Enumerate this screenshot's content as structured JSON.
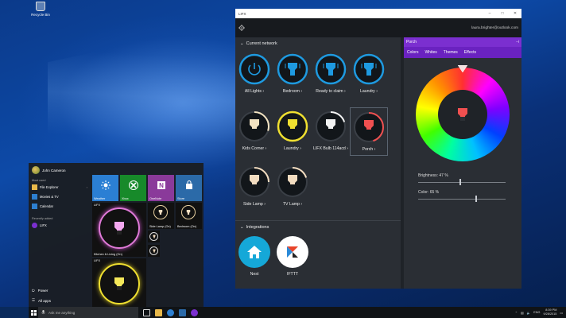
{
  "desktop": {
    "recycle_bin_label": "Recycle Bin"
  },
  "start_menu": {
    "user_name": "John Cameron",
    "most_used_label": "Most used",
    "most_used": [
      {
        "label": "File Explorer",
        "icon": "folder-icon",
        "color": "#e8b84a"
      },
      {
        "label": "Movies & TV",
        "icon": "film-icon",
        "color": "#2d7fd0"
      },
      {
        "label": "Calendar",
        "icon": "calendar-icon",
        "color": "#2d7fd0"
      }
    ],
    "recently_added_label": "Recently added",
    "recently_added": [
      {
        "label": "LIFX",
        "icon": "lifx-icon",
        "color": "#7b2fd0"
      }
    ],
    "power_label": "Power",
    "all_apps_label": "All apps",
    "tiles": {
      "weather": "Weather",
      "xbox": "Xbox",
      "onenote": "OneNote",
      "store": "Store",
      "lifx_group": "LIFX",
      "lifx_group2": "LIFX",
      "kitchen": "Kitchen & Living (On)",
      "side_lamp": "Side Lamp (On)",
      "bedroom": "Bedroom (On)"
    },
    "colors": {
      "weather": "#2b7fd4",
      "xbox": "#178a2a",
      "onenote": "#8a3a9a",
      "store": "#2b6aa8"
    }
  },
  "taskbar": {
    "search_placeholder": "Ask me anything",
    "time": "8:39 PM",
    "date": "9/28/2015",
    "language": "ENG"
  },
  "app": {
    "title": "LIFX",
    "account": "laura.brighter@outlook.com",
    "current_network_label": "Current network",
    "lights": [
      {
        "label": "All Lights",
        "chev": "›",
        "style": "power",
        "color": "#1e9ae0"
      },
      {
        "label": "Bedroom",
        "chev": "›",
        "style": "group",
        "color": "#1e9ae0"
      },
      {
        "label": "Ready to claim",
        "chev": "›",
        "style": "group",
        "color": "#1e9ae0"
      },
      {
        "label": "Laundry",
        "chev": "›",
        "style": "group",
        "color": "#1e9ae0"
      },
      {
        "label": "Kids Corner",
        "chev": "›",
        "style": "bulb",
        "color": "#f2e3c2",
        "level": 0.3
      },
      {
        "label": "Laundry",
        "chev": "›",
        "style": "bulb-on",
        "color": "#f0e030",
        "level": 1.0
      },
      {
        "label": "LIFX Bulb 114acd",
        "chev": "›",
        "style": "bulb",
        "color": "#f2f2f2",
        "level": 0.2
      },
      {
        "label": "Porch",
        "chev": "›",
        "style": "bulb",
        "color": "#f05050",
        "level": 0.45
      },
      {
        "label": "Side Lamp",
        "chev": "›",
        "style": "bulb",
        "color": "#f2dcc0",
        "level": 0.25
      },
      {
        "label": "TV Lamp",
        "chev": "›",
        "style": "bulb",
        "color": "#f2dcc0",
        "level": 0.2
      }
    ],
    "integrations_label": "Integrations",
    "integrations": [
      {
        "label": "Nest",
        "color": "#15a8d8"
      },
      {
        "label": "IFTTT",
        "color": "#ffffff"
      }
    ],
    "panel": {
      "title": "Porch",
      "tabs": [
        "Colors",
        "Whites",
        "Themes",
        "Effects"
      ],
      "brightness_label": "Brightness:  47 %",
      "brightness": 0.47,
      "color_label": "Color:  65 %",
      "color_level": 0.65,
      "accent": "#7b2fd0",
      "bulb_color": "#f05050"
    }
  }
}
